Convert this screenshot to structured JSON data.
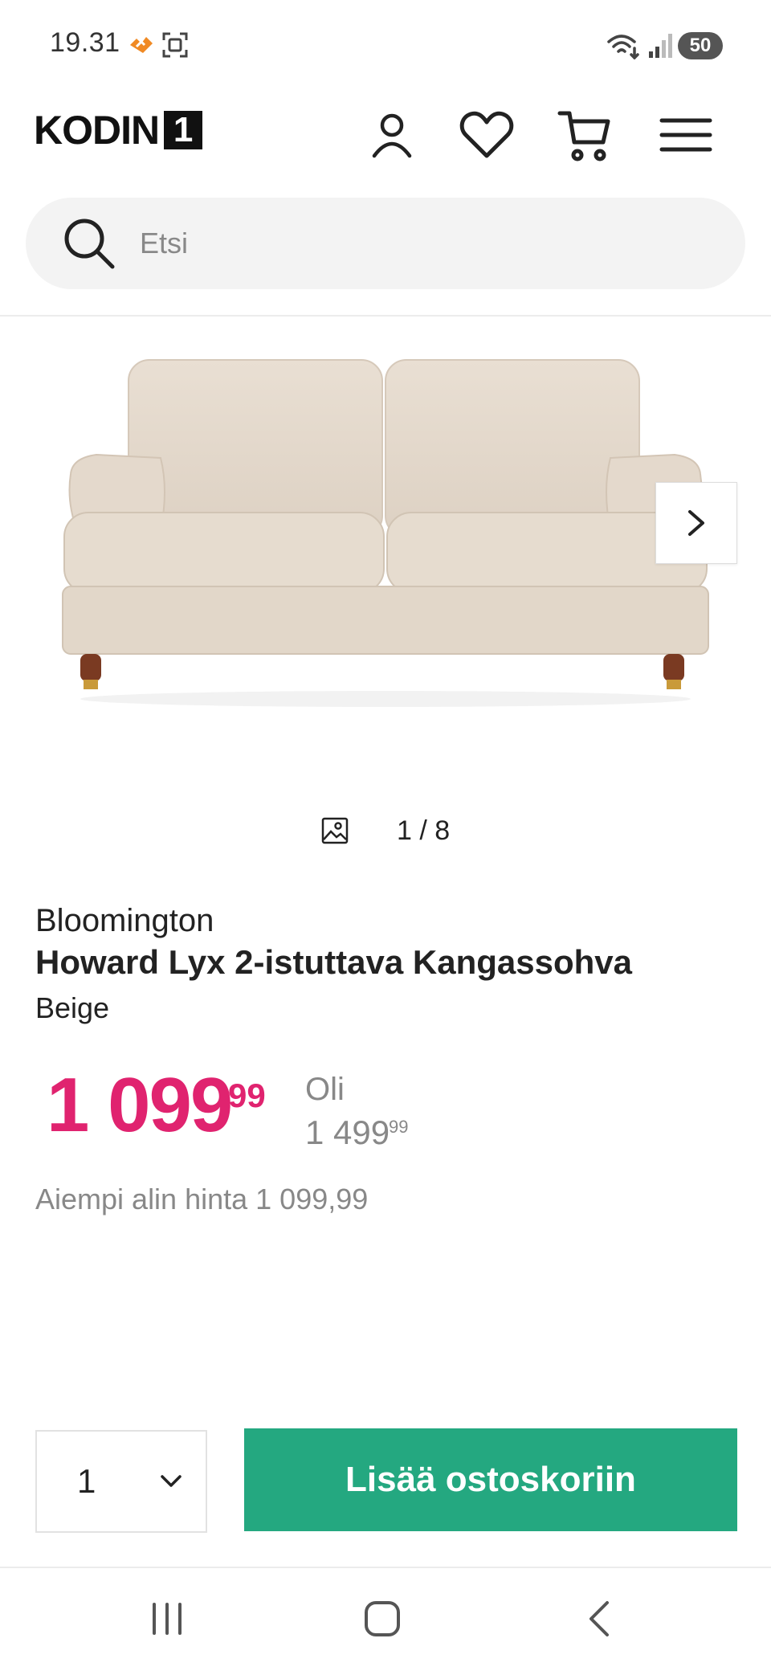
{
  "status_bar": {
    "time": "19.31",
    "battery": "50"
  },
  "header": {
    "logo_text": "KODIN",
    "logo_number": "1",
    "icons": [
      "user-icon",
      "heart-icon",
      "cart-icon",
      "menu-icon"
    ]
  },
  "search": {
    "placeholder": "Etsi"
  },
  "gallery": {
    "counter": "1 / 8"
  },
  "product": {
    "brand": "Bloomington",
    "name": "Howard Lyx 2-istuttava Kangassohva",
    "variant": "Beige",
    "price_main": "1 099",
    "price_cents": "99",
    "old_label": "Oli",
    "old_price_main": "1 499",
    "old_price_cents": "99",
    "lowest_price_text": "Aiempi alin hinta 1 099,99"
  },
  "purchase": {
    "quantity": "1",
    "add_to_cart_label": "Lisää ostoskoriin"
  },
  "colors": {
    "price": "#e0236f",
    "cta": "#24a880"
  }
}
